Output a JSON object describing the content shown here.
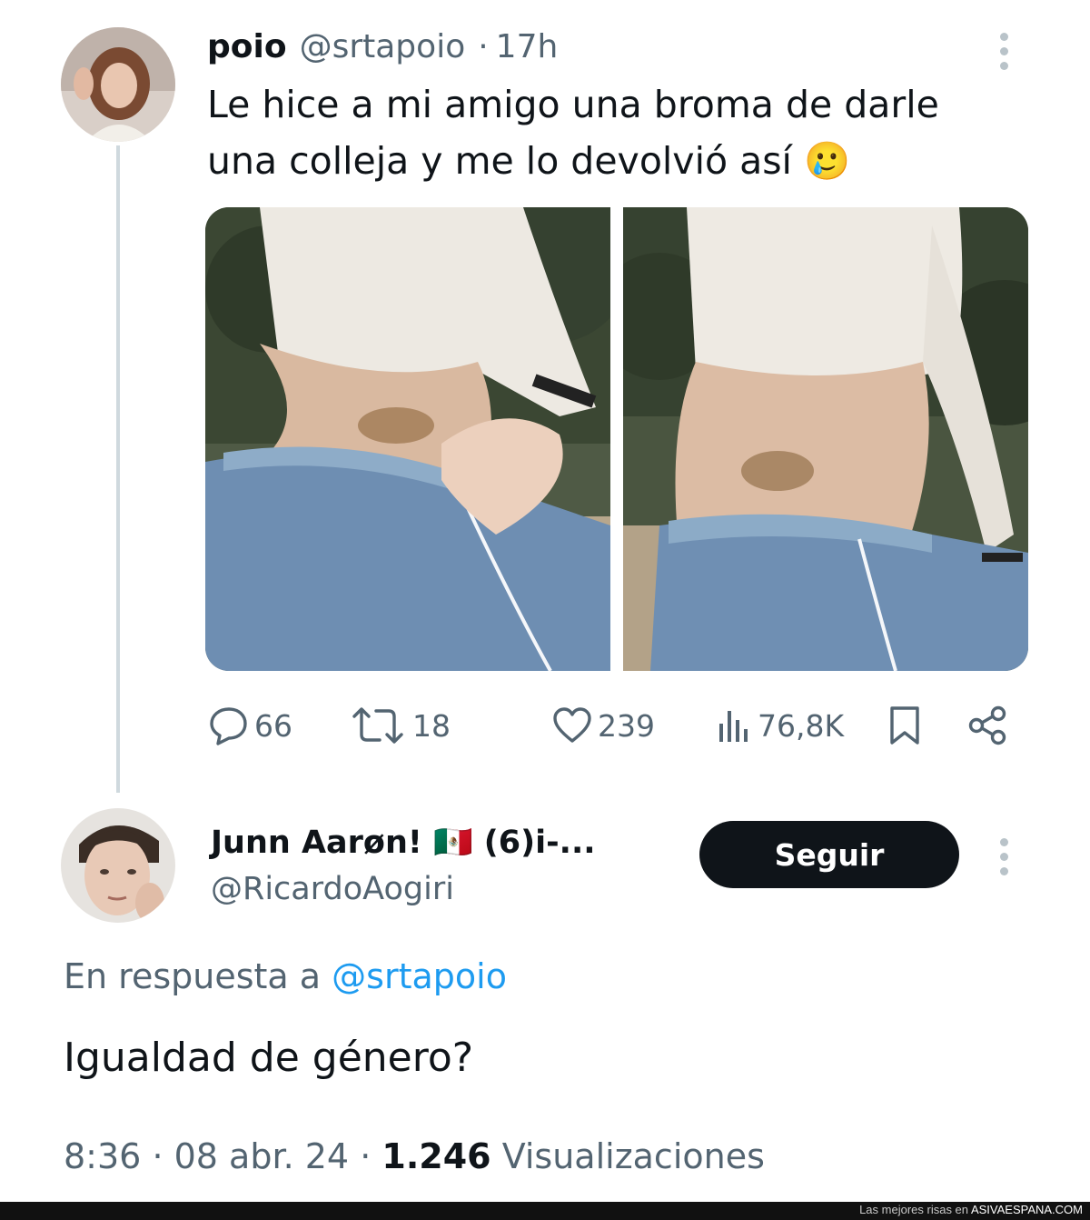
{
  "tweet": {
    "display_name": "poio",
    "handle": "@srtapoio",
    "separator": "·",
    "time": "17h",
    "text": "Le hice a mi amigo una broma de darle una colleja y me lo devolvió así",
    "emoji": "🥲",
    "media": [
      {
        "subject": "bruised belly photo 1"
      },
      {
        "subject": "bruised belly photo 2"
      }
    ],
    "actions": {
      "replies": "66",
      "retweets": "18",
      "likes": "239",
      "views": "76,8K"
    }
  },
  "reply": {
    "display_name": "Junn Aarøn! 🇲🇽 (6)i-...",
    "handle": "@RicardoAogiri",
    "follow_label": "Seguir",
    "in_reply_prefix": "En respuesta a",
    "in_reply_mention": "@srtapoio",
    "text": "Igualdad de género?",
    "time": "8:36",
    "date": "08 abr. 24",
    "views_count": "1.246",
    "views_label": "Visualizaciones",
    "separator": "·"
  },
  "watermark": {
    "prefix": "Las mejores risas en",
    "site": "ASIVAESPANA.COM"
  },
  "colors": {
    "text": "#0f1419",
    "secondary": "#536471",
    "link": "#1d9bf0",
    "button": "#0f1419"
  }
}
